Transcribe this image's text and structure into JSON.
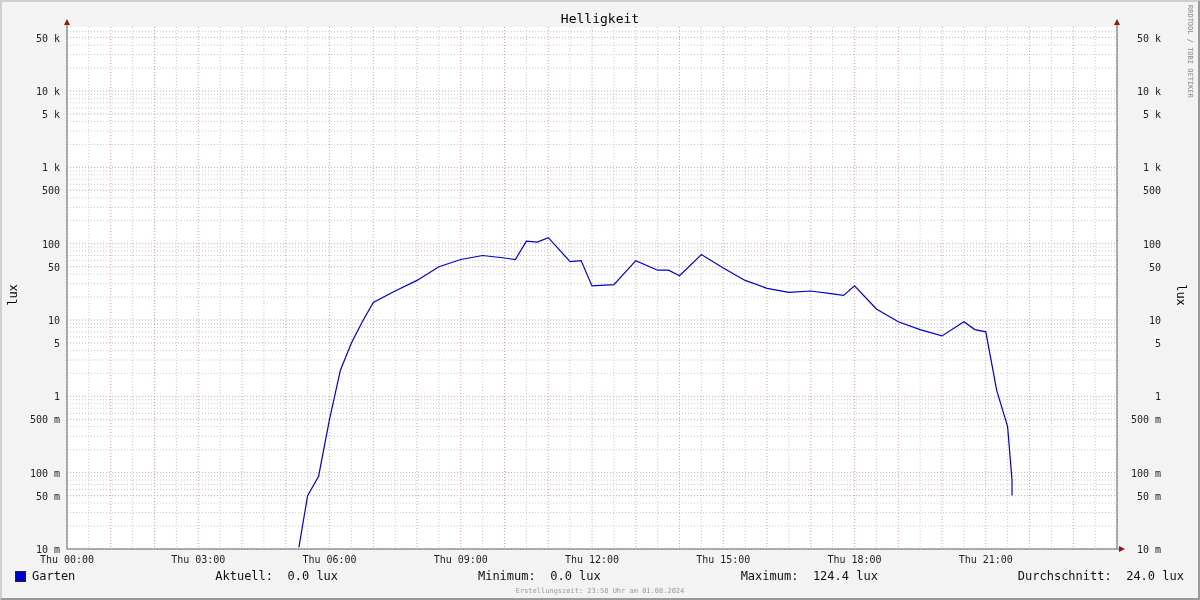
{
  "title": "Helligkeit",
  "watermark": "RRDTOOL / TOBI OETIKER",
  "ylabel": "lux",
  "ylabel_right": "lux",
  "left_ticks": [
    "50 k",
    "10 k",
    "5 k",
    "1 k",
    "500",
    "100",
    "50",
    "10",
    "5",
    "1",
    "500 m",
    "100 m",
    "50 m",
    "10 m"
  ],
  "right_ticks": [
    "50 k",
    "10 k",
    "5 k",
    "1 k",
    "500",
    "100",
    "50",
    "10",
    "5",
    "1",
    "500 m",
    "100 m",
    "50 m",
    "10 m"
  ],
  "x_ticks": [
    "Thu 00:00",
    "Thu 03:00",
    "Thu 06:00",
    "Thu 09:00",
    "Thu 12:00",
    "Thu 15:00",
    "Thu 18:00",
    "Thu 21:00"
  ],
  "legend": {
    "series_name": "Garten",
    "color": "#0000cc",
    "stats": [
      {
        "label": "Aktuell:",
        "value": "0.0 lux"
      },
      {
        "label": "Minimum:",
        "value": "0.0 lux"
      },
      {
        "label": "Maximum:",
        "value": "124.4 lux"
      },
      {
        "label": "Durchschnitt:",
        "value": "24.0 lux"
      }
    ]
  },
  "footer": "Erstellungszeit: 23:58 Uhr am 01.08.2024"
}
